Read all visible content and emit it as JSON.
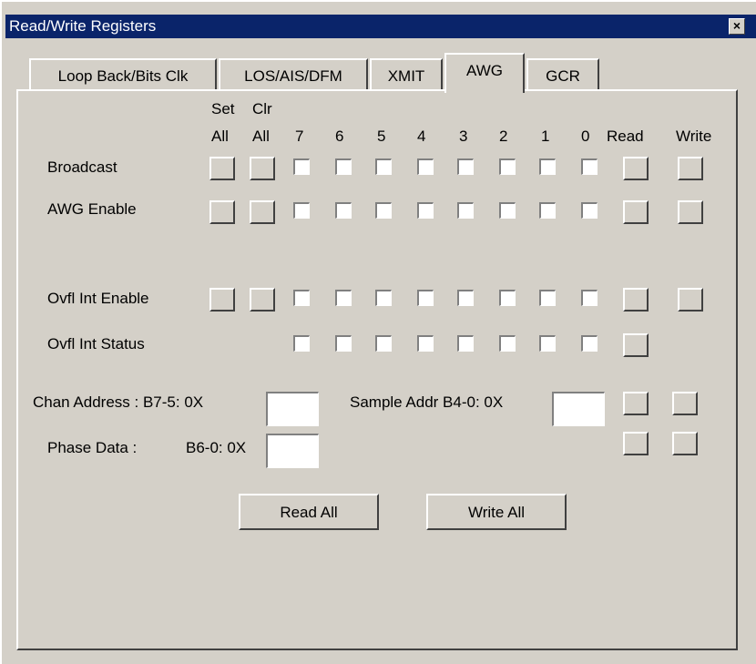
{
  "window": {
    "title": "Read/Write Registers",
    "close_icon": "×"
  },
  "tabs": [
    {
      "label": "Loop Back/Bits Clk"
    },
    {
      "label": "LOS/AIS/DFM"
    },
    {
      "label": "XMIT"
    },
    {
      "label": "AWG"
    },
    {
      "label": "GCR"
    }
  ],
  "active_tab": "AWG",
  "headers": {
    "set_top": "Set",
    "set_bottom": "All",
    "clr_top": "Clr",
    "clr_bottom": "All",
    "bits": [
      "7",
      "6",
      "5",
      "4",
      "3",
      "2",
      "1",
      "0"
    ],
    "read": "Read",
    "write": "Write"
  },
  "rows": {
    "broadcast": "Broadcast",
    "awg_enable": "AWG Enable",
    "ovfl_int_enable": "Ovfl Int Enable",
    "ovfl_int_status": "Ovfl Int Status"
  },
  "fields": {
    "chan_address_label": "Chan Address : B7-5: 0X",
    "chan_address_value": "",
    "sample_addr_label": "Sample Addr B4-0: 0X",
    "sample_addr_value": "",
    "phase_data_label": "Phase Data :",
    "phase_bits_label": "B6-0: 0X",
    "phase_data_value": ""
  },
  "buttons": {
    "read_all": "Read All",
    "write_all": "Write All"
  }
}
